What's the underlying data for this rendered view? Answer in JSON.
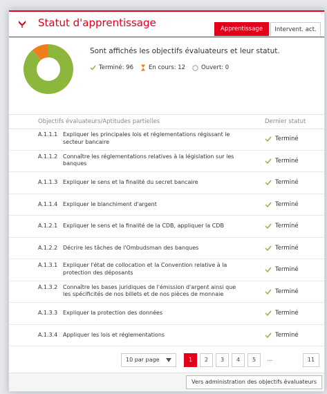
{
  "header": {
    "title": "Statut d'apprentissage",
    "tabs": [
      {
        "label": "Apprentissage",
        "active": true
      },
      {
        "label": "Intervent. act.",
        "active": false
      }
    ]
  },
  "summary": {
    "text": "Sont affichés les objectifs évaluateurs et leur statut.",
    "done_label": "Terminé:",
    "done_count": "96",
    "progress_label": "En cours:",
    "progress_count": "12",
    "open_label": "Ouvert:",
    "open_count": "0"
  },
  "chart_data": {
    "type": "pie",
    "categories": [
      "Terminé",
      "En cours",
      "Ouvert"
    ],
    "values": [
      96,
      12,
      0
    ],
    "colors": [
      "#8db63c",
      "#f07d1c",
      "#cccccc"
    ]
  },
  "table": {
    "col_objectives": "Objectifs évaluateurs/Aptitudes partielles",
    "col_status": "Dernier statut",
    "rows": [
      {
        "code": "A.1.1.1",
        "text": "Expliquer les principales lois et réglementations régissant le secteur bancaire",
        "status": "Terminé"
      },
      {
        "code": "A.1.1.2",
        "text": "Connaître les réglementations relatives à la législation sur les banques",
        "status": "Terminé"
      },
      {
        "code": "A.1.1.3",
        "text": "Expliquer le sens et la finalité du secret bancaire",
        "status": "Terminé"
      },
      {
        "code": "A.1.1.4",
        "text": "Expliquer le blanchiment d'argent",
        "status": "Terminé"
      },
      {
        "code": "A.1.2.1",
        "text": "Expliquer le sens et la finalité de la CDB, appliquer la CDB",
        "status": "Terminé"
      },
      {
        "code": "A.1.2.2",
        "text": "Décrire les tâches de l'Ombudsman des banques",
        "status": "Terminé"
      },
      {
        "code": "A.1.3.1",
        "text": "Expliquer l'état de collocation et la Convention relative à la protection des déposants",
        "status": "Terminé"
      },
      {
        "code": "A.1.3.2",
        "text": "Connaître les bases juridiques de l'émission d'argent ainsi que les spécificités de nos billets et de nos pièces de monnaie",
        "status": "Terminé"
      },
      {
        "code": "A.1.3.3",
        "text": "Expliquer la protection des données",
        "status": "Terminé"
      },
      {
        "code": "A.1.3.4",
        "text": "Appliquer les lois et réglementations",
        "status": "Terminé"
      }
    ]
  },
  "pagination": {
    "per_page": "10 par page",
    "pages": [
      "1",
      "2",
      "3",
      "4",
      "5",
      "...",
      "11"
    ],
    "current": "1"
  },
  "footer": {
    "button_label": "Vers administration des objectifs évaluateurs"
  },
  "colors": {
    "accent": "#e1001a",
    "done": "#8db63c",
    "in_progress": "#f07d1c"
  }
}
